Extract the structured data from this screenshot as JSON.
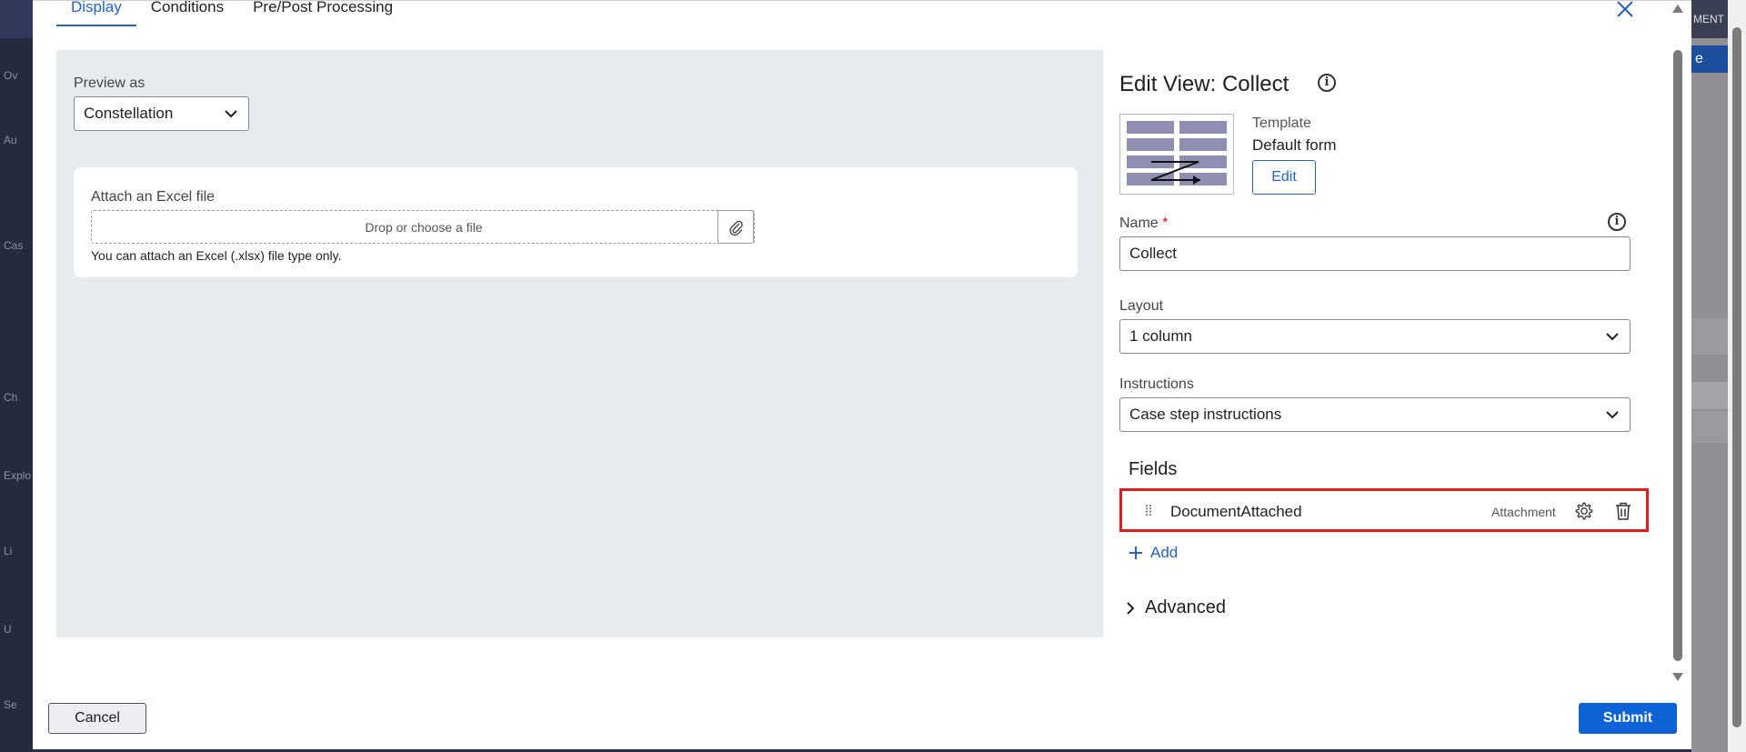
{
  "background": {
    "sidebar_labels": [
      "Ov",
      "Au",
      "Cas",
      "Ch",
      "Explo",
      "Li",
      "U",
      "Se"
    ],
    "right_labels": [
      "MENT",
      "e"
    ]
  },
  "tabs": [
    {
      "label": "Display",
      "active": true
    },
    {
      "label": "Conditions",
      "active": false
    },
    {
      "label": "Pre/Post Processing",
      "active": false
    }
  ],
  "preview": {
    "label": "Preview as",
    "selected": "Constellation",
    "card": {
      "title": "Attach an Excel file",
      "drop_text": "Drop or choose a file",
      "help": "You can attach an Excel (.xlsx) file type only."
    }
  },
  "panel": {
    "title": "Edit View: Collect",
    "template": {
      "label": "Template",
      "value": "Default form",
      "edit_label": "Edit"
    },
    "name": {
      "label": "Name",
      "required_mark": "*",
      "value": "Collect"
    },
    "layout": {
      "label": "Layout",
      "value": "1 column"
    },
    "instructions": {
      "label": "Instructions",
      "value": "Case step instructions"
    },
    "fields_title": "Fields",
    "fields": [
      {
        "name": "DocumentAttached",
        "type": "Attachment"
      }
    ],
    "add_label": "Add",
    "advanced_label": "Advanced"
  },
  "footer": {
    "cancel_label": "Cancel",
    "submit_label": "Submit"
  },
  "colors": {
    "accent": "#2463c7",
    "submit": "#0d63d6",
    "highlight": "#e01c1c",
    "preview_bg": "#e6ebef"
  }
}
